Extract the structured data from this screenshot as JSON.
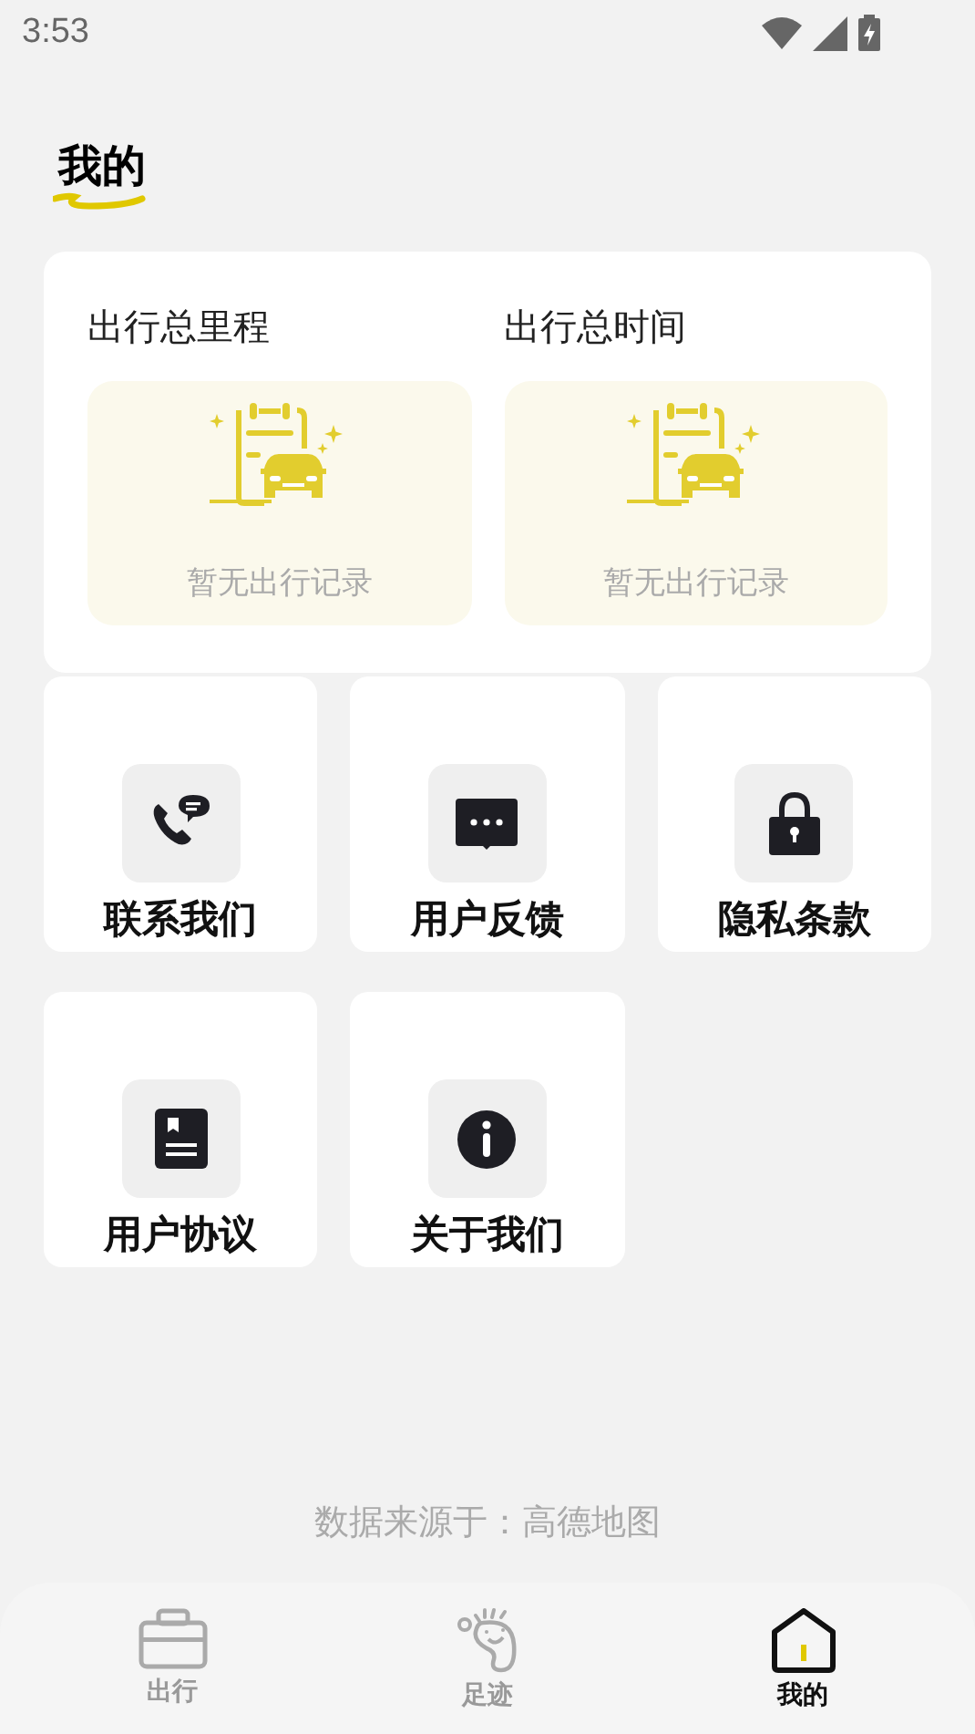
{
  "status_bar": {
    "time": "3:53"
  },
  "page_title": "我的",
  "stats": [
    {
      "title": "出行总里程",
      "empty_text": "暂无出行记录"
    },
    {
      "title": "出行总时间",
      "empty_text": "暂无出行记录"
    }
  ],
  "menu": [
    {
      "label": "联系我们"
    },
    {
      "label": "用户反馈"
    },
    {
      "label": "隐私条款"
    },
    {
      "label": "用户协议"
    },
    {
      "label": "关于我们"
    }
  ],
  "data_source": "数据来源于：高德地图",
  "bottom_nav": [
    {
      "label": "出行",
      "selected": false
    },
    {
      "label": "足迹",
      "selected": false
    },
    {
      "label": "我的",
      "selected": true
    }
  ]
}
